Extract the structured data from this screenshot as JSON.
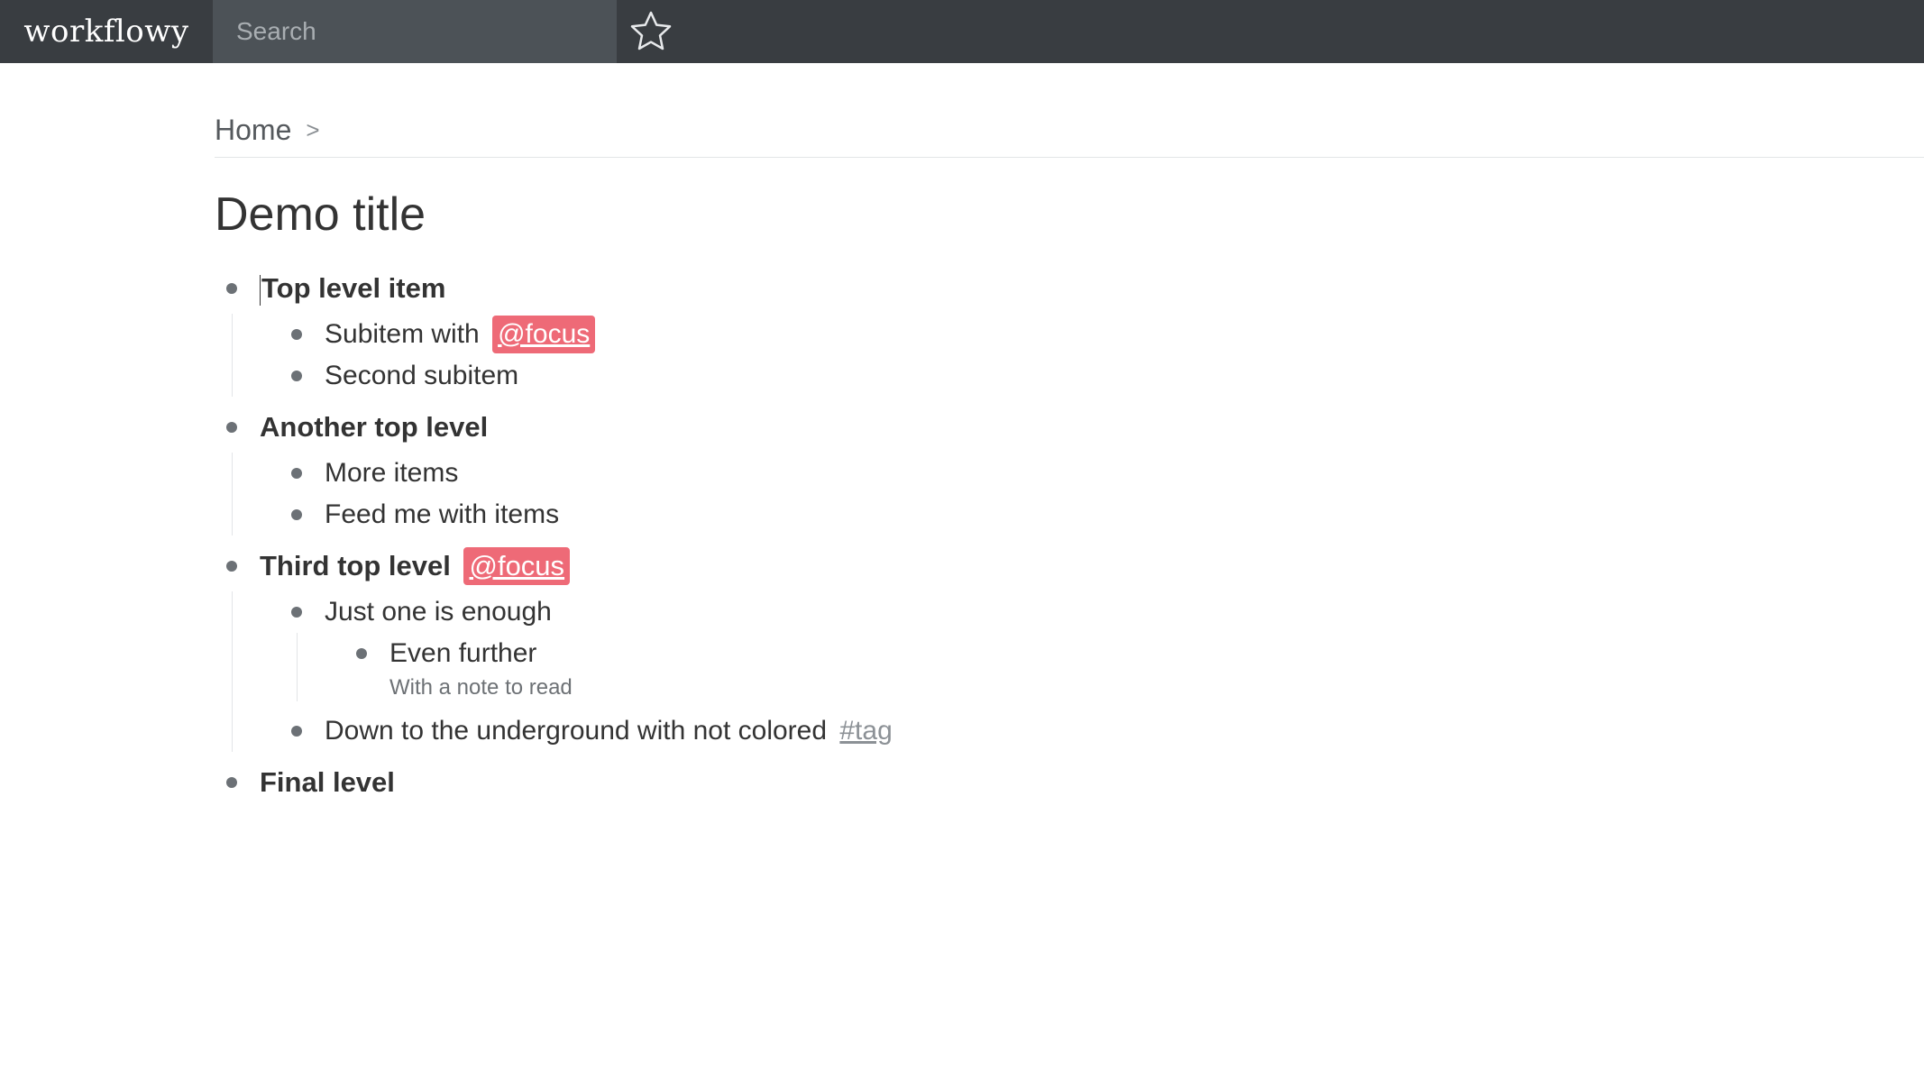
{
  "app": {
    "logo": "workflowy",
    "search_placeholder": "Search"
  },
  "breadcrumb": {
    "home": "Home",
    "separator": ">"
  },
  "page": {
    "title": "Demo title"
  },
  "outline": [
    {
      "text": "Top level item",
      "children": [
        {
          "text": "Subitem with",
          "tag": "@focus"
        },
        {
          "text": "Second subitem"
        }
      ]
    },
    {
      "text": "Another top level",
      "children": [
        {
          "text": "More items"
        },
        {
          "text": "Feed me with items"
        }
      ]
    },
    {
      "text": "Third top level",
      "tag": "@focus",
      "children": [
        {
          "text": "Just one is enough",
          "children": [
            {
              "text": "Even further",
              "note": "With a note to read"
            }
          ]
        },
        {
          "text": "Down to the underground with not colored",
          "plain_tag": "#tag"
        }
      ]
    },
    {
      "text": "Final level"
    }
  ],
  "colors": {
    "topbar": "#393d41",
    "search_bg": "#4c5257",
    "focus_tag_bg": "#ee6a77",
    "plain_tag": "#8c9196"
  },
  "icons": {
    "star": "star-icon",
    "bullet": "bullet-icon"
  }
}
